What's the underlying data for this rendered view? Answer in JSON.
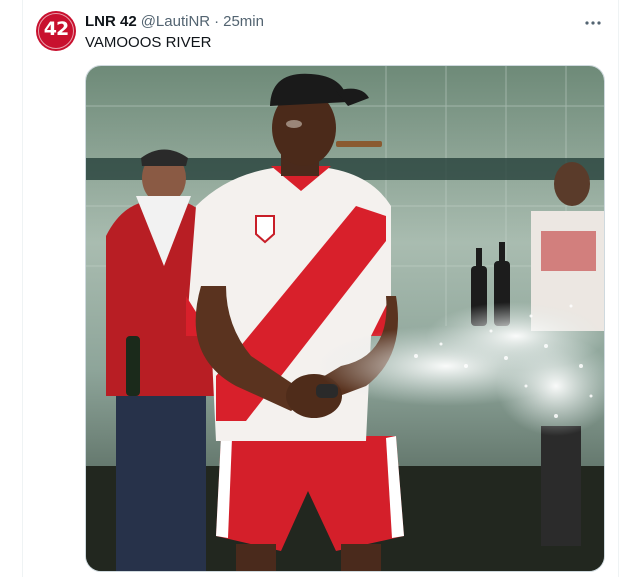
{
  "tweet": {
    "display_name": "LNR 42",
    "handle": "@LautiNR",
    "separator": "·",
    "time": "25min",
    "text": "VAMOOOS RIVER"
  },
  "avatar": {
    "text": "42"
  },
  "colors": {
    "text_primary": "#0f1419",
    "text_secondary": "#536471",
    "border": "#cfd9de",
    "avatar_red": "#c8102e"
  },
  "icons": {
    "more": "more-horizontal-icon"
  },
  "media": {
    "type": "photo"
  }
}
